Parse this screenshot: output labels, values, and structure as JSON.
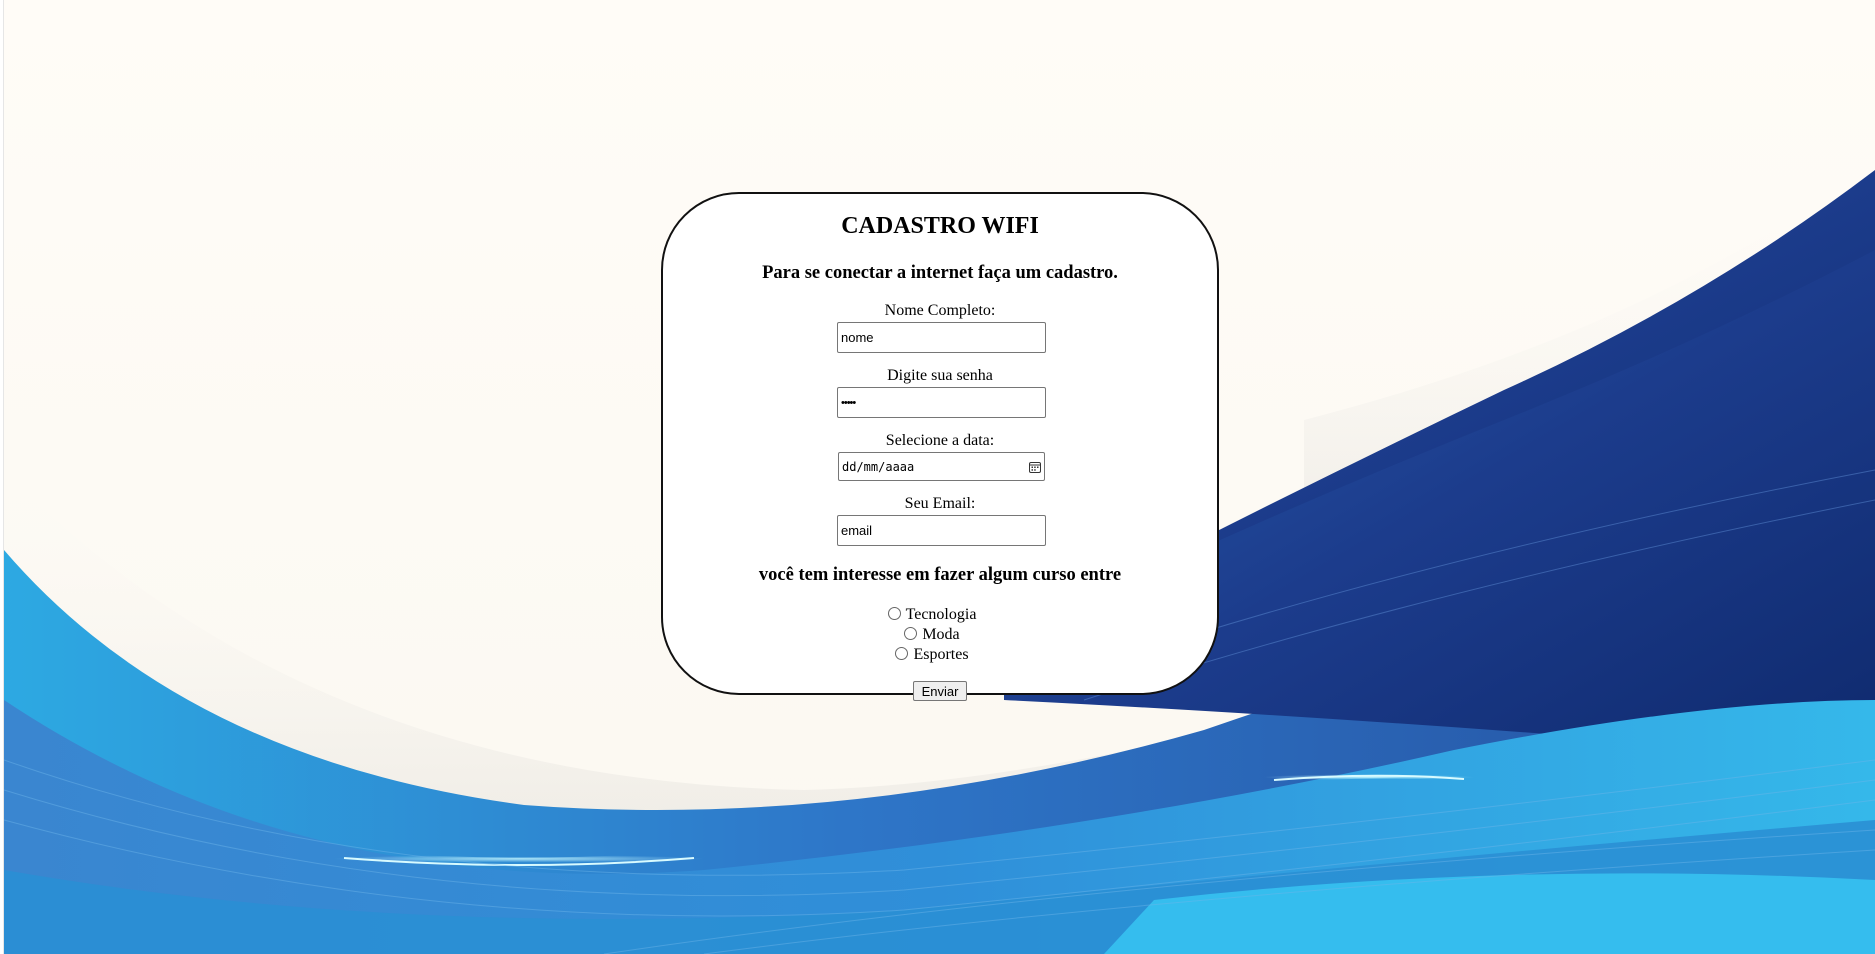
{
  "form": {
    "title": "CADASTRO WIFI",
    "subtitle": "Para se conectar a internet faça um cadastro.",
    "name_label": "Nome Completo:",
    "name_value": "nome",
    "password_label": "Digite sua senha",
    "password_value": "•••••",
    "date_label": "Selecione a data:",
    "date_placeholder": "dd/mm/aaaa",
    "email_label": "Seu Email:",
    "email_value": "email",
    "question": "você tem interesse em fazer algum curso entre",
    "options": [
      {
        "label": "Tecnologia",
        "checked": false
      },
      {
        "label": "Moda",
        "checked": false
      },
      {
        "label": "Esportes",
        "checked": false
      }
    ],
    "submit_label": "Enviar"
  },
  "colors": {
    "card_border": "#111111",
    "wallpaper_cream": "#fffcf6",
    "wallpaper_blue_dark": "#1d3f8d",
    "wallpaper_blue_mid": "#2f6fc0",
    "wallpaper_blue_light": "#34b6e8"
  }
}
